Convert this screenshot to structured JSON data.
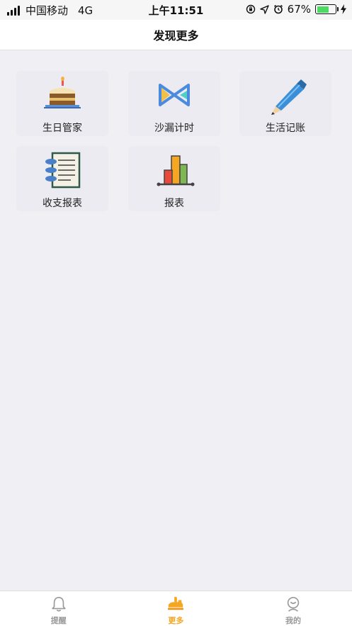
{
  "status_bar": {
    "carrier": "中国移动",
    "network": "4G",
    "time": "上午11:51",
    "battery_percent": "67%",
    "battery_level": 0.67
  },
  "nav": {
    "title": "发现更多"
  },
  "tiles": [
    {
      "label": "生日管家",
      "icon": "birthday-cake-icon"
    },
    {
      "label": "沙漏计时",
      "icon": "hourglass-icon"
    },
    {
      "label": "生活记账",
      "icon": "pencil-icon"
    },
    {
      "label": "收支报表",
      "icon": "ledger-document-icon"
    },
    {
      "label": "报表",
      "icon": "bar-chart-icon"
    }
  ],
  "tab_bar": {
    "items": [
      {
        "label": "提醒",
        "icon": "bell-icon",
        "active": false
      },
      {
        "label": "更多",
        "icon": "more-hand-icon",
        "active": true
      },
      {
        "label": "我的",
        "icon": "profile-icon",
        "active": false
      }
    ]
  },
  "colors": {
    "accent": "#f5a623",
    "background": "#f0eff4",
    "tile": "#ebebf1",
    "inactive_tab": "#999999"
  }
}
